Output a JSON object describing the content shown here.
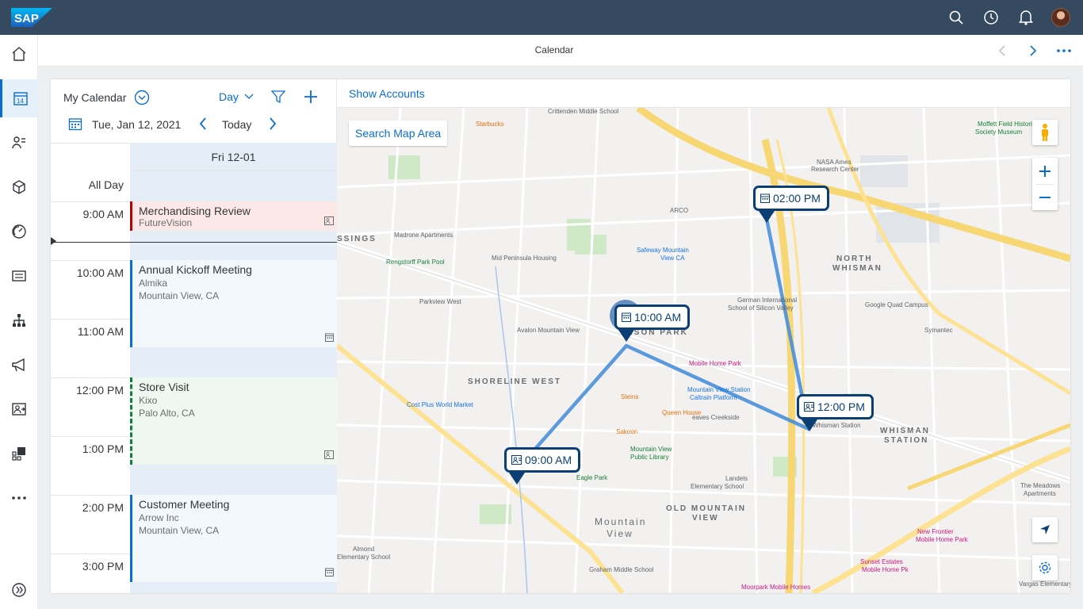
{
  "shell": {
    "logo_text": "SAP",
    "icons": [
      "search-icon",
      "history-icon",
      "bell-icon",
      "user-avatar"
    ]
  },
  "nav": {
    "items": [
      "home-icon",
      "calendar-icon",
      "contacts-icon",
      "products-icon",
      "dashboard-icon",
      "list-icon",
      "hierarchy-icon",
      "megaphone-icon",
      "visits-icon",
      "analytics-icon",
      "more-icon",
      "expand-icon"
    ],
    "active_index": 1,
    "calendar_day": "14"
  },
  "header": {
    "title": "Calendar"
  },
  "calendar": {
    "name": "My Calendar",
    "view": "Day",
    "date": "Tue, Jan 12,  2021",
    "today_label": "Today",
    "column_header": "Fri 12-01",
    "all_day_label": "All Day",
    "times": [
      "9:00 AM",
      "10:00 AM",
      "11:00 AM",
      "12:00 PM",
      "1:00 PM",
      "2:00 PM",
      "3:00 PM"
    ],
    "events": [
      {
        "title": "Merchandising Review",
        "sub1": "FutureVision",
        "sub2": "",
        "color": "#bb0000",
        "bg": "#fde8e8"
      },
      {
        "title": "Annual Kickoff Meeting",
        "sub1": "Almika",
        "sub2": "Mountain View, CA",
        "color": "#0a6ed1",
        "bg": "#f3f8fd"
      },
      {
        "title": "Store Visit",
        "sub1": "Kixo",
        "sub2": "Palo Alto, CA",
        "color": "#107e3e",
        "bg": "#eef8f0"
      },
      {
        "title": "Customer Meeting",
        "sub1": "Arrow Inc",
        "sub2": "Mountain View, CA",
        "color": "#0a6ed1",
        "bg": "#f3f8fd"
      }
    ]
  },
  "map": {
    "show_accounts": "Show Accounts",
    "search_area": "Search Map Area",
    "pins": [
      "02:00 PM",
      "10:00 AM",
      "12:00 PM",
      "09:00 AM"
    ],
    "areas": [
      "SHORELINE WEST",
      "OLD MOUNTAIN",
      "VIEW",
      "NORTH",
      "WHISMAN",
      "WHISMAN",
      "STATION",
      "SSINGS",
      "Mountain",
      "View",
      "ISON PARK"
    ],
    "places": [
      "Crittenden Middle School",
      "Starbucks",
      "Moffett Field Historical",
      "Society Museum",
      "NASA Ames",
      "Research Center",
      "Madrone Apartments",
      "ARCO",
      "Rengstorff Park Pool",
      "Mid Peninsula Housing",
      "Safeway Mountain",
      "View CA",
      "Parkview West",
      "Avalon Mountain View",
      "German International",
      "School of Silicon Valley",
      "Google Quad Campus",
      "Symantec",
      "Cost Plus World Market",
      "Mountain View Station",
      "Caltrain Platform",
      "Steins",
      "Queen House",
      "Sakoon",
      "Mountain View",
      "Public Library",
      "Landels",
      "Elementary School",
      "Eagle Park",
      "Graham Middle School",
      "Almond",
      "Elementary School",
      "The Meadows",
      "Apartments",
      "New Frontier",
      "Mobile Home Park",
      "Sunset Estates",
      "Mobile Home Pk",
      "Moorpark Mobile Homes",
      "Vargas Elementary",
      "Mobile Home Park",
      "eaves Creekside",
      "Whisman Station"
    ]
  },
  "colors": {
    "shell": "#354a5f",
    "accent": "#0a6ed1",
    "pin": "#0b3f73",
    "route": "#4a90d9"
  }
}
